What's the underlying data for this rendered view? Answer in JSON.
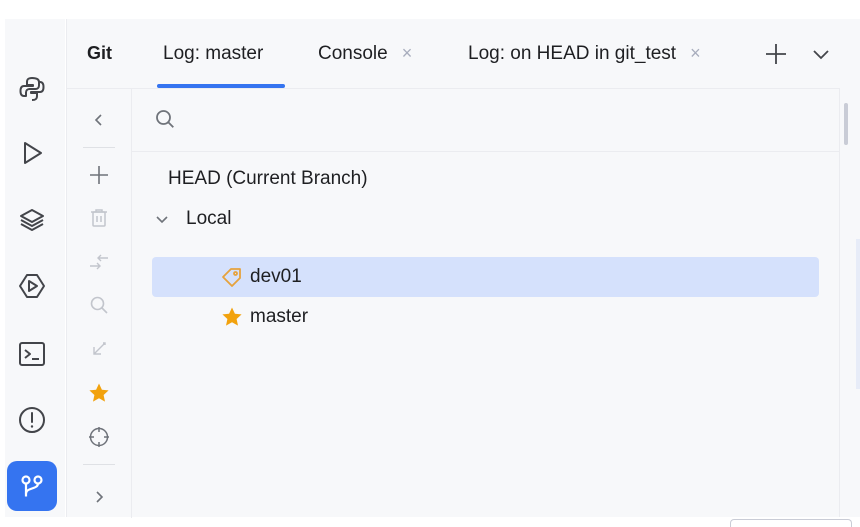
{
  "tabs": {
    "git_label": "Git",
    "log_master": "Log: master",
    "console": "Console",
    "log_head": "Log: on HEAD in git_test",
    "close_glyph": "×"
  },
  "search": {
    "value": "",
    "placeholder": ""
  },
  "tree": {
    "head": "HEAD (Current Branch)",
    "local": "Local",
    "branches": [
      {
        "name": "dev01",
        "icon": "tag-icon",
        "selected": true
      },
      {
        "name": "master",
        "icon": "star-icon",
        "selected": false
      }
    ]
  },
  "toolstrip": {
    "items": [
      "python-icon",
      "run-icon",
      "layers-icon",
      "services-icon",
      "terminal-icon",
      "problems-icon",
      "git-icon"
    ],
    "active": "git-icon"
  },
  "colors": {
    "accent": "#3574f0",
    "selection": "#d5e1fc",
    "star": "#f2a20d",
    "tag": "#e6a23c"
  }
}
